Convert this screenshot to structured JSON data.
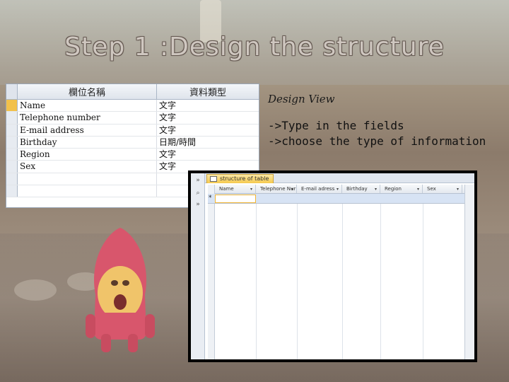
{
  "slide": {
    "title": "Step 1 :Design the structure",
    "design_label": "Design View",
    "instructions": [
      "->Type in the fields",
      "->choose the type of information"
    ]
  },
  "design_table": {
    "headers": [
      "欄位名稱",
      "資料類型"
    ],
    "rows": [
      {
        "field": "Name",
        "type": "文字"
      },
      {
        "field": "Telephone number",
        "type": "文字"
      },
      {
        "field": "E-mail address",
        "type": "文字"
      },
      {
        "field": "Birthday",
        "type": "日期/時間"
      },
      {
        "field": "Region",
        "type": "文字"
      },
      {
        "field": "Sex",
        "type": "文字"
      }
    ],
    "selected_row_color": "#f2c14a"
  },
  "datasheet": {
    "tab_label": "structure of table",
    "columns": [
      "Name",
      "Telephone Nur",
      "E-mail adress",
      "Birthday",
      "Region",
      "Sex"
    ],
    "new_record_marker": "*",
    "accent": "#f5c94e"
  }
}
